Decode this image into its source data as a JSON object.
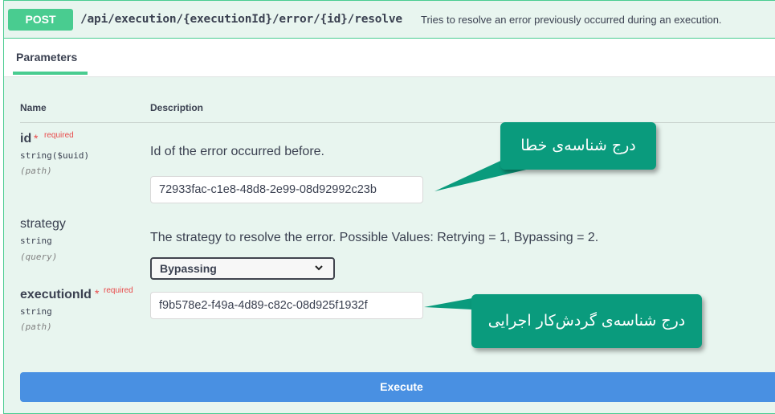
{
  "endpoint": {
    "method": "POST",
    "path": "/api/execution/{executionId}/error/{id}/resolve",
    "summary": "Tries to resolve an error previously occurred during an execution."
  },
  "tabs": {
    "parameters": "Parameters"
  },
  "table": {
    "name_header": "Name",
    "description_header": "Description"
  },
  "params": {
    "id": {
      "name": "id",
      "required_star": "*",
      "required_label": "required",
      "type": "string($uuid)",
      "in": "(path)",
      "description": "Id of the error occurred before.",
      "value": "72933fac-c1e8-48d8-2e99-08d92992c23b"
    },
    "strategy": {
      "name": "strategy",
      "type": "string",
      "in": "(query)",
      "description": "The strategy to resolve the error. Possible Values: Retrying = 1, Bypassing = 2.",
      "selected": "Bypassing"
    },
    "executionId": {
      "name": "executionId",
      "required_star": "*",
      "required_label": "required",
      "type": "string",
      "in": "(path)",
      "value": "f9b578e2-f49a-4d89-c82c-08d925f1932f"
    }
  },
  "execute_label": "Execute",
  "callouts": {
    "error_id": "درج شناسه‌ی خطا",
    "execution_id": "درج شناسه‌ی گردش‌کار اجرایی"
  },
  "colors": {
    "post": "#49cc90",
    "execute": "#4990e2",
    "callout": "#0a9b7d",
    "required": "#e84a4a"
  },
  "icons": {
    "select_chevron": "chevron-down-icon"
  }
}
